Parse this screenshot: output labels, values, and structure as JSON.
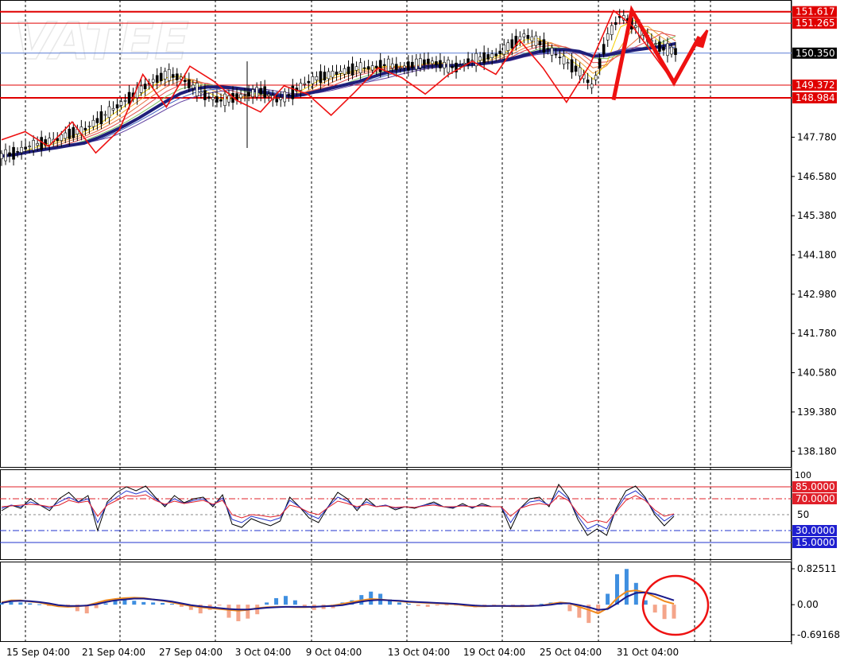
{
  "watermark": "VATEE",
  "colors": {
    "background": "#ffffff",
    "price_line": "#e00000",
    "current_price_line": "#5b7fd6",
    "ribbon_slow": "#1f1f7a",
    "oscillator_black": "#000000",
    "oscillator_blue": "#2233cc",
    "oscillator_red": "#e0202a",
    "hist_positive": "#3f8fe0",
    "hist_negative": "#f4a58a",
    "signal_orange": "#f08a1c",
    "signal_navy": "#1a1a8a",
    "zigzag": "#ee1111",
    "highlight_circle": "#ee1111"
  },
  "chart_data": [
    {
      "type": "candlestick",
      "name": "price",
      "x_ticks": [
        "15 Sep 04:00",
        "21 Sep 04:00",
        "27 Sep 04:00",
        "3 Oct 04:00",
        "9 Oct 04:00",
        "13 Oct 04:00",
        "19 Oct 04:00",
        "25 Oct 04:00",
        "31 Oct 04:00"
      ],
      "y_ticks": [
        147.78,
        146.58,
        145.38,
        144.18,
        142.98,
        141.78,
        140.58,
        139.38,
        138.18
      ],
      "y_tick_labels": [
        "147.780",
        "146.580",
        "145.380",
        "144.180",
        "142.980",
        "141.780",
        "140.580",
        "139.380",
        "138.180"
      ],
      "ylim": [
        137.7,
        151.95
      ],
      "horizontal_levels": [
        {
          "label": "151.617",
          "value": 151.617
        },
        {
          "label": "151.265",
          "value": 151.265
        },
        {
          "label": "149.372",
          "value": 149.372
        },
        {
          "label": "148.984",
          "value": 148.984
        }
      ],
      "current_price": {
        "label": "150.350",
        "value": 150.35
      },
      "close_series": [
        147.2,
        147.3,
        147.5,
        147.6,
        147.7,
        147.9,
        148.0,
        148.3,
        148.6,
        148.9,
        149.2,
        149.5,
        149.7,
        149.6,
        149.3,
        149.0,
        148.9,
        149.0,
        149.1,
        149.2,
        148.9,
        149.1,
        149.4,
        149.6,
        149.7,
        149.8,
        149.9,
        149.9,
        150.0,
        149.9,
        150.0,
        150.1,
        150.0,
        149.9,
        150.1,
        150.2,
        150.3,
        150.6,
        150.9,
        150.7,
        150.4,
        150.1,
        149.8,
        149.3,
        150.8,
        151.5,
        151.2,
        150.8,
        150.5,
        150.4
      ],
      "zigzag_points": [
        147.7,
        147.95,
        147.5,
        148.25,
        147.3,
        148.0,
        149.7,
        148.7,
        149.95,
        149.5,
        148.9,
        148.55,
        149.35,
        149.1,
        148.45,
        149.15,
        149.9,
        149.6,
        149.1,
        149.7,
        150.1,
        149.7,
        150.75,
        149.9,
        148.85,
        150.0,
        151.65,
        151.2,
        149.45
      ],
      "projection_points": [
        151.2,
        149.45,
        150.75
      ]
    },
    {
      "type": "line",
      "name": "oscillator",
      "ylim": [
        0,
        100
      ],
      "y_ticks": [
        100,
        50
      ],
      "levels": [
        {
          "label": "85.0000",
          "value": 85
        },
        {
          "label": "70.0000",
          "value": 70
        },
        {
          "label": "30.0000",
          "value": 30
        },
        {
          "label": "15.0000",
          "value": 15
        }
      ],
      "series": [
        {
          "values": [
            55,
            62,
            58,
            70,
            62,
            55,
            70,
            78,
            66,
            74,
            30,
            66,
            78,
            85,
            80,
            86,
            72,
            60,
            74,
            65,
            70,
            72,
            60,
            75,
            38,
            34,
            45,
            40,
            36,
            42,
            72,
            60,
            46,
            40,
            60,
            78,
            70,
            55,
            70,
            60,
            62,
            56,
            60,
            58,
            62,
            66,
            60,
            58,
            64,
            58,
            64,
            60,
            60,
            32,
            58,
            70,
            72,
            60,
            88,
            72,
            44,
            24,
            32,
            24,
            58,
            80,
            86,
            72,
            50,
            36,
            48
          ]
        },
        {
          "values": [
            58,
            62,
            60,
            66,
            62,
            58,
            66,
            72,
            66,
            70,
            40,
            64,
            72,
            80,
            76,
            80,
            70,
            62,
            70,
            64,
            68,
            70,
            62,
            71,
            44,
            40,
            48,
            45,
            42,
            46,
            68,
            60,
            50,
            45,
            60,
            72,
            67,
            58,
            66,
            60,
            62,
            58,
            60,
            59,
            62,
            64,
            60,
            59,
            62,
            59,
            62,
            60,
            60,
            40,
            58,
            66,
            68,
            62,
            80,
            70,
            48,
            32,
            38,
            32,
            56,
            74,
            80,
            70,
            53,
            42,
            50
          ]
        },
        {
          "values": [
            60,
            61,
            62,
            63,
            62,
            60,
            62,
            68,
            65,
            67,
            48,
            62,
            68,
            74,
            73,
            75,
            68,
            63,
            67,
            64,
            66,
            68,
            63,
            68,
            50,
            46,
            50,
            49,
            47,
            49,
            62,
            59,
            53,
            50,
            59,
            67,
            64,
            60,
            63,
            60,
            61,
            59,
            60,
            59,
            61,
            62,
            60,
            60,
            61,
            60,
            61,
            60,
            60,
            48,
            58,
            62,
            64,
            62,
            74,
            68,
            52,
            40,
            43,
            40,
            54,
            68,
            74,
            68,
            56,
            48,
            51
          ]
        }
      ]
    },
    {
      "type": "bar",
      "name": "histogram",
      "ylim": [
        -0.69168,
        0.82511
      ],
      "y_ticks": [
        0.82511,
        0.0,
        -0.69168
      ],
      "y_tick_labels": [
        "0.82511",
        "0.00",
        "-0.69168"
      ],
      "histogram": [
        0.04,
        0.06,
        0.05,
        0.03,
        0.01,
        -0.03,
        -0.05,
        -0.02,
        -0.15,
        -0.2,
        -0.08,
        0.03,
        0.1,
        0.12,
        0.09,
        0.06,
        0.05,
        0.04,
        0.02,
        -0.05,
        -0.12,
        -0.2,
        -0.12,
        -0.02,
        -0.3,
        -0.38,
        -0.32,
        -0.22,
        0.05,
        0.15,
        0.2,
        0.1,
        -0.05,
        -0.12,
        -0.1,
        -0.08,
        0.05,
        0.1,
        0.22,
        0.3,
        0.25,
        0.12,
        0.05,
        0.02,
        -0.03,
        -0.05,
        -0.02,
        -0.01,
        -0.02,
        -0.04,
        -0.06,
        -0.05,
        -0.03,
        -0.02,
        -0.04,
        -0.05,
        -0.03,
        0.02,
        0.05,
        0.02,
        -0.15,
        -0.3,
        -0.42,
        -0.2,
        0.25,
        0.7,
        0.82,
        0.5,
        0.1,
        -0.18,
        -0.33,
        -0.32
      ],
      "series": [
        {
          "values": [
            0.05,
            0.1,
            0.1,
            0.07,
            0.05,
            0.0,
            -0.04,
            -0.05,
            -0.04,
            -0.02,
            0.04,
            0.1,
            0.13,
            0.15,
            0.16,
            0.15,
            0.12,
            0.09,
            0.05,
            0.01,
            -0.03,
            -0.06,
            -0.08,
            -0.1,
            -0.12,
            -0.14,
            -0.12,
            -0.08,
            -0.06,
            -0.05,
            -0.05,
            -0.06,
            -0.06,
            -0.05,
            -0.04,
            -0.02,
            0.02,
            0.06,
            0.1,
            0.13,
            0.12,
            0.1,
            0.08,
            0.06,
            0.05,
            0.04,
            0.03,
            0.02,
            0.01,
            -0.02,
            -0.04,
            -0.04,
            -0.03,
            -0.03,
            -0.04,
            -0.04,
            -0.03,
            -0.02,
            0.02,
            0.05,
            0.03,
            -0.05,
            -0.12,
            -0.2,
            -0.08,
            0.15,
            0.3,
            0.33,
            0.28,
            0.18,
            0.08,
            0.02
          ]
        },
        {
          "values": [
            0.04,
            0.08,
            0.09,
            0.08,
            0.06,
            0.03,
            -0.01,
            -0.03,
            -0.03,
            -0.02,
            0.01,
            0.06,
            0.1,
            0.12,
            0.14,
            0.14,
            0.12,
            0.1,
            0.07,
            0.03,
            -0.01,
            -0.04,
            -0.06,
            -0.08,
            -0.1,
            -0.11,
            -0.11,
            -0.09,
            -0.07,
            -0.06,
            -0.05,
            -0.05,
            -0.05,
            -0.05,
            -0.04,
            -0.03,
            -0.01,
            0.03,
            0.07,
            0.1,
            0.11,
            0.1,
            0.09,
            0.07,
            0.06,
            0.05,
            0.04,
            0.03,
            0.02,
            0.0,
            -0.02,
            -0.03,
            -0.03,
            -0.03,
            -0.03,
            -0.03,
            -0.03,
            -0.02,
            0.0,
            0.03,
            0.03,
            -0.01,
            -0.06,
            -0.12,
            -0.1,
            0.03,
            0.18,
            0.27,
            0.28,
            0.24,
            0.17,
            0.1
          ]
        }
      ]
    }
  ]
}
